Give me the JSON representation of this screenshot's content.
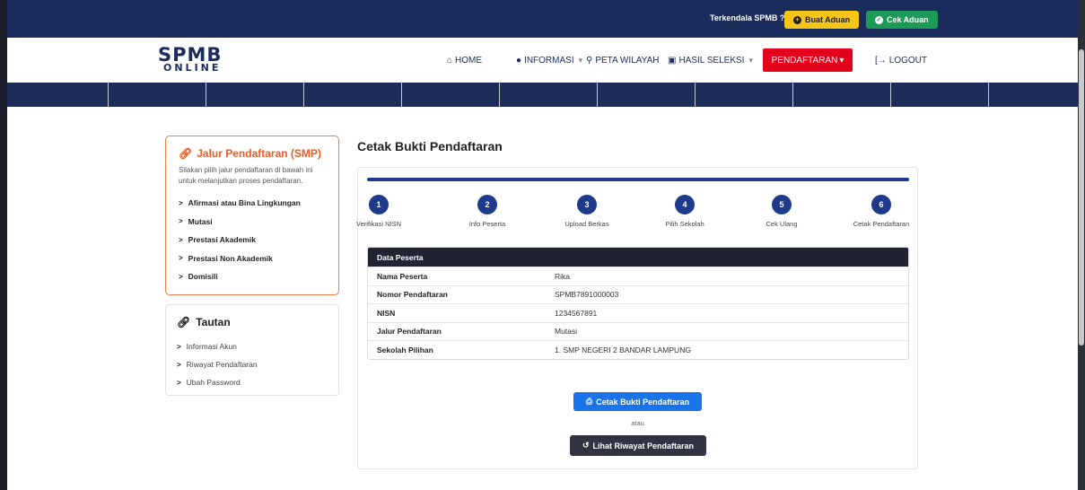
{
  "topbar": {
    "question": "Terkendala SPMB ?",
    "buat_aduan": "Buat Aduan",
    "cek_aduan": "Cek Aduan"
  },
  "logo": {
    "line1": "SPMB",
    "line2": "ONLINE"
  },
  "nav": {
    "home": "HOME",
    "informasi": "INFORMASI",
    "peta": "PETA WILAYAH",
    "hasil": "HASIL SELEKSI",
    "pendaftaran": "PENDAFTARAN",
    "logout": "LOGOUT"
  },
  "sidebar": {
    "jalur_title": "Jalur Pendaftaran (SMP)",
    "jalur_desc": "Silakan pilih jalur pendaftaran di bawah ini untuk melanjutkan proses pendaftaran.",
    "jalur_items": [
      "Afirmasi atau Bina Lingkungan",
      "Mutasi",
      "Prestasi Akademik",
      "Prestasi Non Akademik",
      "Domisili"
    ],
    "tautan_title": "Tautan",
    "tautan_items": [
      "Informasi Akun",
      "Riwayat Pendaftaran",
      "Ubah Password"
    ]
  },
  "main": {
    "title": "Cetak Bukti Pendaftaran",
    "progress_fraction": 1.0,
    "steps": [
      {
        "num": "1",
        "label": "Verifikasi NISN"
      },
      {
        "num": "2",
        "label": "Info Peserta"
      },
      {
        "num": "3",
        "label": "Upload Berkas"
      },
      {
        "num": "4",
        "label": "Pilih Sekolah"
      },
      {
        "num": "5",
        "label": "Cek Ulang"
      },
      {
        "num": "6",
        "label": "Cetak Pendaftaran"
      }
    ],
    "table_header": "Data Peserta",
    "rows": [
      {
        "key": "Nama Peserta",
        "value": "Rika"
      },
      {
        "key": "Nomor Pendaftaran",
        "value": "SPMB7891000003"
      },
      {
        "key": "NISN",
        "value": "1234567891"
      },
      {
        "key": "Jalur Pendaftaran",
        "value": "Mutasi"
      },
      {
        "key": "Sekolah Pilihan",
        "value": "1. SMP NEGERI 2 BANDAR LAMPUNG"
      }
    ],
    "btn_cetak": "Cetak Bukti Pendaftaran",
    "atau": "atau",
    "btn_riwayat": "Lihat Riwayat Pendaftaran"
  },
  "colors": {
    "navy": "#1a2c5b",
    "accent_orange": "#ef5a1e",
    "pendaftaran_red": "#e3001b",
    "primary_blue": "#1a73e8"
  }
}
